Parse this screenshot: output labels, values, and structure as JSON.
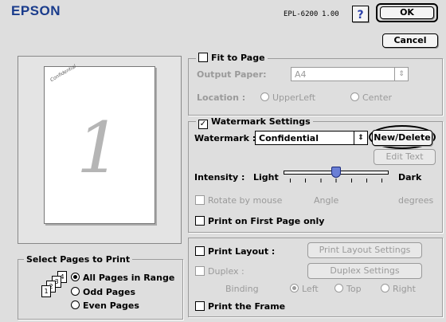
{
  "header": {
    "brand": "EPSON",
    "model": "EPL-6200",
    "version": "1.00",
    "help_label": "?",
    "ok_label": "OK",
    "cancel_label": "Cancel"
  },
  "preview": {
    "page_number": "1",
    "watermark_text": "Confidential"
  },
  "fit_to_page": {
    "label": "Fit to Page",
    "checked": false,
    "output_paper_label": "Output Paper:",
    "output_paper_value": "A4",
    "location_label": "Location :",
    "location_options": [
      "UpperLeft",
      "Center"
    ]
  },
  "watermark": {
    "settings_label": "Watermark Settings",
    "checked": true,
    "watermark_label": "Watermark :",
    "watermark_value": "Confidential",
    "new_delete_label": "New/Delete",
    "edit_text_label": "Edit Text",
    "intensity_label": "Intensity :",
    "intensity_min_label": "Light",
    "intensity_max_label": "Dark",
    "intensity_level": 0.5,
    "rotate_label": "Rotate by mouse",
    "angle_label": "Angle",
    "degrees_label": "degrees",
    "first_page_label": "Print on First Page only"
  },
  "layout": {
    "print_layout_label": "Print Layout :",
    "print_layout_settings_label": "Print Layout Settings",
    "duplex_label": "Duplex :",
    "duplex_settings_label": "Duplex Settings",
    "binding_label": "Binding",
    "binding_options": [
      "Left",
      "Top",
      "Right"
    ],
    "binding_selected": "Left",
    "print_frame_label": "Print the Frame"
  },
  "pages": {
    "group_label": "Select Pages to Print",
    "options": [
      "All Pages in Range",
      "Odd Pages",
      "Even Pages"
    ],
    "selected": "All Pages in Range",
    "icon_numbers": [
      "1",
      "2",
      "3",
      "4"
    ]
  },
  "colors": {
    "window_bg": "#dedede",
    "brand_blue": "#1a3c8c",
    "slider_thumb": "#6a7fd6",
    "disabled_text": "#9a9a9a"
  }
}
